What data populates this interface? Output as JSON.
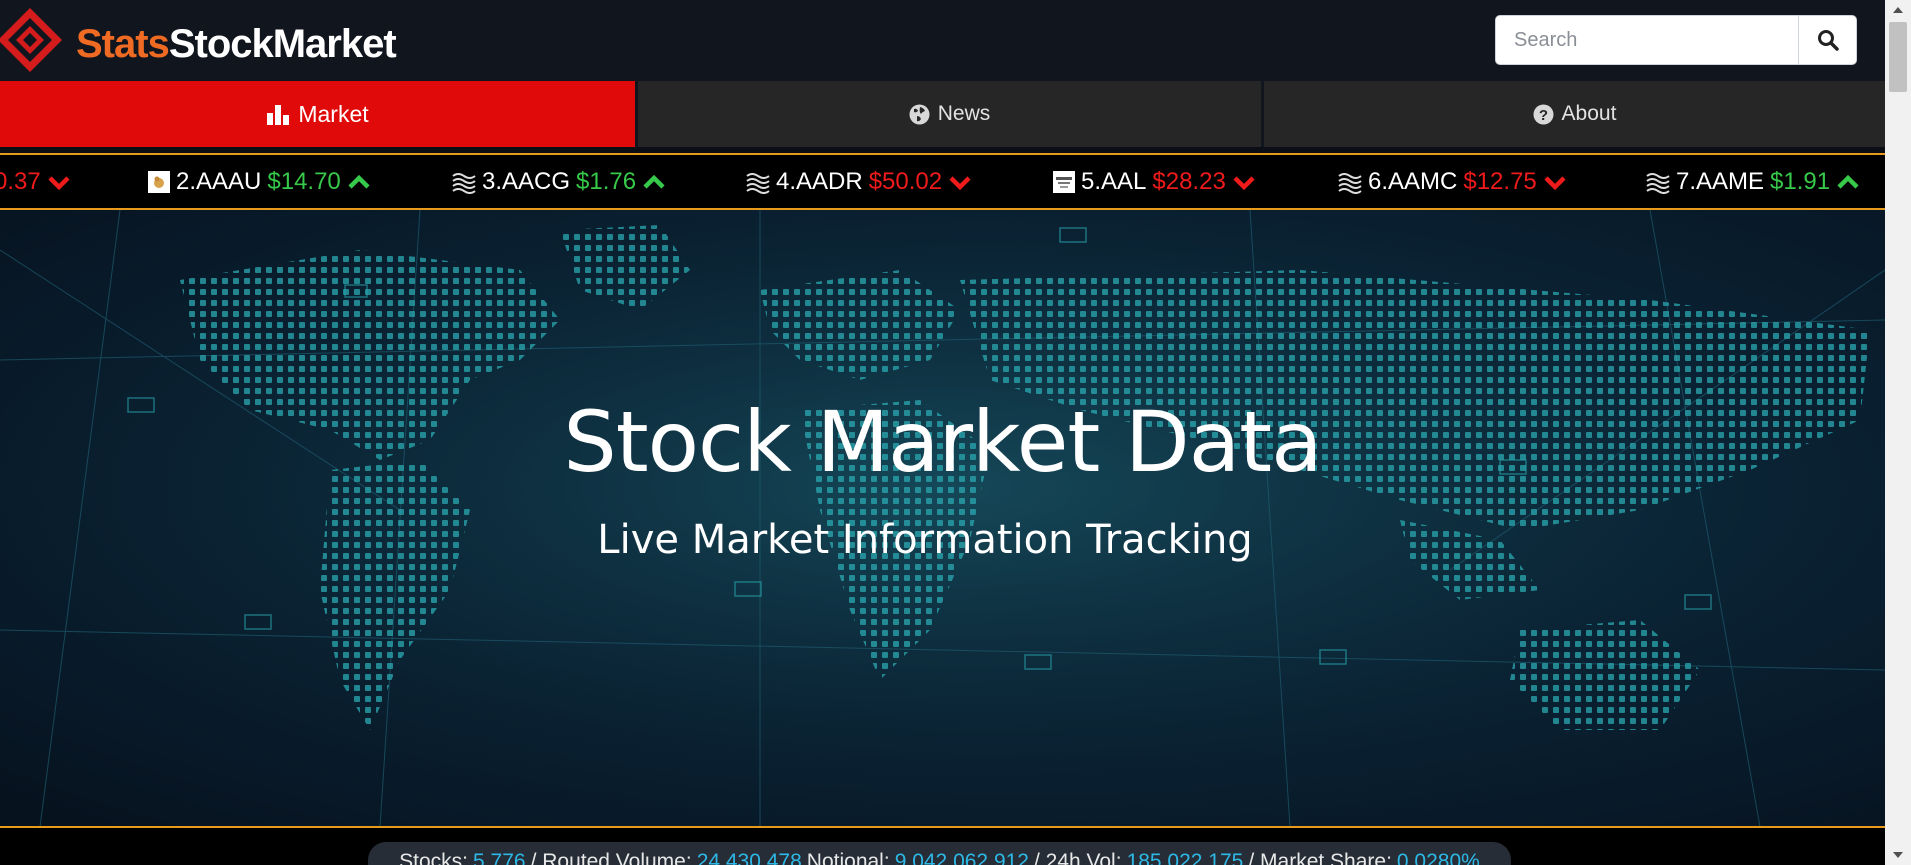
{
  "header": {
    "logo_part1": "Stats",
    "logo_part2": "StockMarket",
    "search_placeholder": "Search"
  },
  "nav": {
    "market": "Market",
    "news": "News",
    "about": "About"
  },
  "ticker": [
    {
      "symbol": "",
      "price": "0.37",
      "direction": "down"
    },
    {
      "symbol": "2.AAAU",
      "price": "$14.70",
      "direction": "up"
    },
    {
      "symbol": "3.AACG",
      "price": "$1.76",
      "direction": "up"
    },
    {
      "symbol": "4.AADR",
      "price": "$50.02",
      "direction": "down"
    },
    {
      "symbol": "5.AAL",
      "price": "$28.23",
      "direction": "down"
    },
    {
      "symbol": "6.AAMC",
      "price": "$12.75",
      "direction": "down"
    },
    {
      "symbol": "7.AAME",
      "price": "$1.91",
      "direction": "up"
    }
  ],
  "hero": {
    "title": "Stock Market Data",
    "subtitle": "Live Market Information Tracking"
  },
  "stats": {
    "stocks_label": "Stocks:",
    "stocks_value": "5,776",
    "routed_label": "/ Routed Volume:",
    "routed_value": "24,430,478",
    "notional_label": "Notional:",
    "notional_value": "9,042,062,912",
    "vol_label": "/ 24h Vol:",
    "vol_value": "185,022,175",
    "share_label": "/ Market Share:",
    "share_value": "0.0280%"
  },
  "colors": {
    "brand_orange": "#ef6a23",
    "nav_active": "#e10a0a",
    "up": "#37c94a",
    "down": "#ef1b1b",
    "accent_border": "#e89a1a",
    "stat_value": "#2eb8e6"
  }
}
